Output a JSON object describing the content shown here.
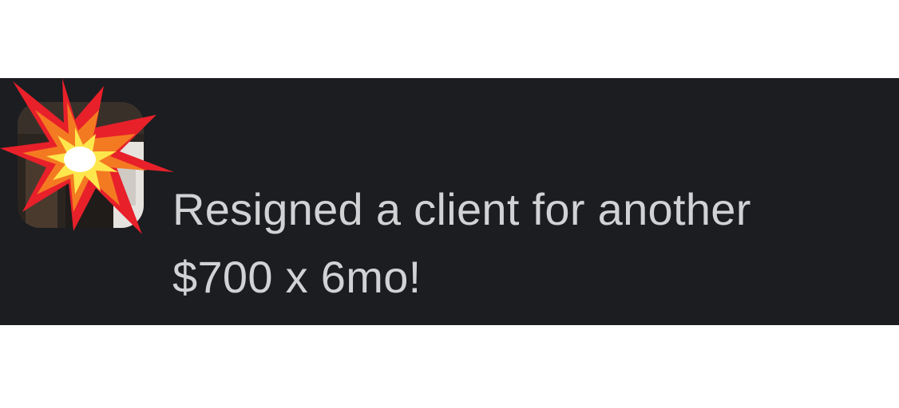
{
  "message": {
    "lines": [
      "Resigned a client for another",
      "$700 x 6mo!"
    ]
  },
  "reaction": {
    "icon": "collision-icon",
    "colors": {
      "outer": "#e8202a",
      "middle": "#f47a22",
      "inner": "#fde74c",
      "core": "#ffffff"
    }
  },
  "colors": {
    "panel_background": "#1b1d21",
    "text": "#d1d2d3",
    "page_background": "#ffffff"
  }
}
